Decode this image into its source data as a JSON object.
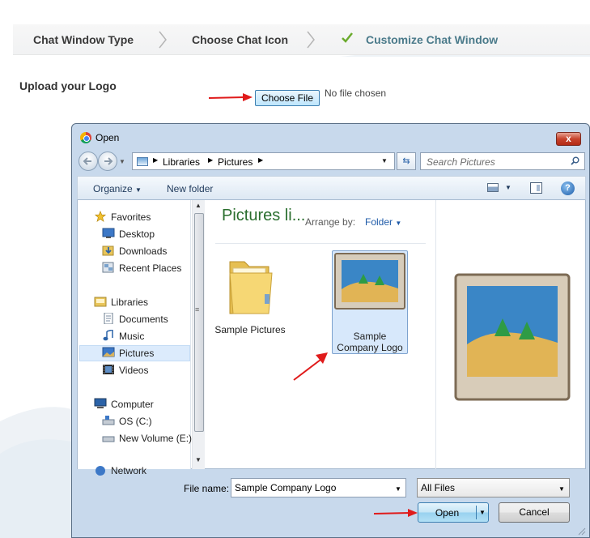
{
  "wizard": {
    "steps": [
      {
        "label": "Chat Window Type"
      },
      {
        "label": "Choose Chat Icon"
      },
      {
        "label": "Customize Chat Window"
      }
    ]
  },
  "upload": {
    "label": "Upload your Logo",
    "button_label": "Choose File",
    "status": "No file chosen"
  },
  "dialog": {
    "title": "Open",
    "close_glyph": "x",
    "address": {
      "crumbs": [
        "Libraries",
        "Pictures"
      ]
    },
    "search_placeholder": "Search Pictures",
    "toolbar": {
      "organize": "Organize",
      "new_folder": "New folder",
      "help_glyph": "?"
    },
    "nav": {
      "favorites": "Favorites",
      "desktop": "Desktop",
      "downloads": "Downloads",
      "recent": "Recent Places",
      "libraries": "Libraries",
      "documents": "Documents",
      "music": "Music",
      "pictures": "Pictures",
      "videos": "Videos",
      "computer": "Computer",
      "os_c": "OS (C:)",
      "new_volume": "New Volume (E:)",
      "network": "Network"
    },
    "content": {
      "header": "Pictures li...",
      "arrange_label": "Arrange by:",
      "arrange_value": "Folder",
      "files": [
        {
          "name": "Sample Pictures"
        },
        {
          "name_line1": "Sample",
          "name_line2": "Company Logo"
        }
      ]
    },
    "filename_label": "File name:",
    "filename_value": "Sample Company Logo",
    "filter_value": "All Files",
    "open_label": "Open",
    "cancel_label": "Cancel"
  },
  "colors": {
    "accent_arrow": "#e01b1b",
    "selection": "#d7e8fb",
    "active_step": "#4a7a8a",
    "library_header": "#2a6e2e"
  }
}
